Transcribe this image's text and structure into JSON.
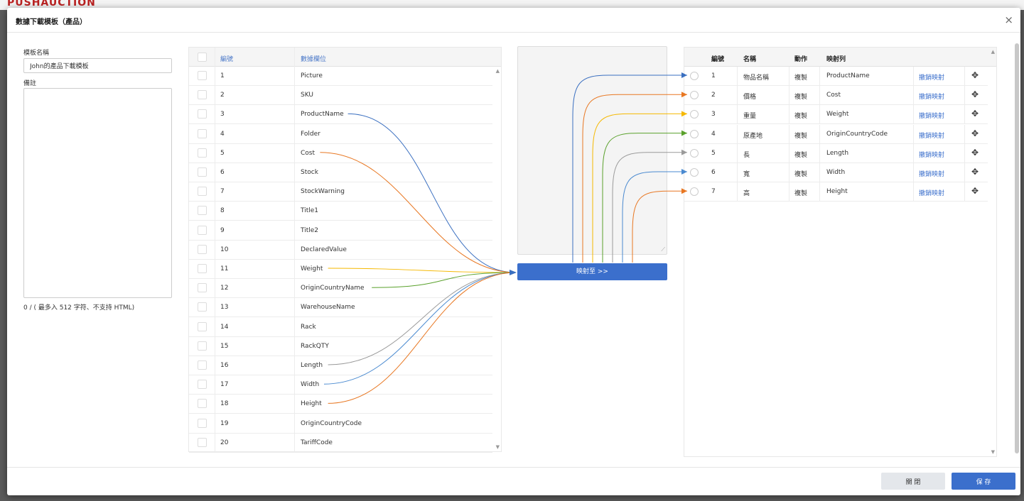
{
  "background": {
    "logo": "PUSHAUCTION"
  },
  "modal": {
    "title": "數據下載模板（產品）",
    "close_icon": "×"
  },
  "form": {
    "name_label": "模板名稱",
    "name_value": "John的產品下載模板",
    "note_label": "備註",
    "counter": "0 / ( 最多入 512 字符、不支持 HTML)"
  },
  "source": {
    "headers": {
      "number": "編號",
      "field": "數據欄位"
    },
    "rows": [
      {
        "n": "1",
        "field": "Picture"
      },
      {
        "n": "2",
        "field": "SKU"
      },
      {
        "n": "3",
        "field": "ProductName"
      },
      {
        "n": "4",
        "field": "Folder"
      },
      {
        "n": "5",
        "field": "Cost"
      },
      {
        "n": "6",
        "field": "Stock"
      },
      {
        "n": "7",
        "field": "StockWarning"
      },
      {
        "n": "8",
        "field": "Title1"
      },
      {
        "n": "9",
        "field": "Title2"
      },
      {
        "n": "10",
        "field": "DeclaredValue"
      },
      {
        "n": "11",
        "field": "Weight"
      },
      {
        "n": "12",
        "field": "OriginCountryName"
      },
      {
        "n": "13",
        "field": "WarehouseName"
      },
      {
        "n": "14",
        "field": "Rack"
      },
      {
        "n": "15",
        "field": "RackQTY"
      },
      {
        "n": "16",
        "field": "Length"
      },
      {
        "n": "17",
        "field": "Width"
      },
      {
        "n": "18",
        "field": "Height"
      },
      {
        "n": "19",
        "field": "OriginCountryCode"
      },
      {
        "n": "20",
        "field": "TariffCode"
      }
    ]
  },
  "map_button": "映射至 >>",
  "target": {
    "headers": {
      "number": "編號",
      "name": "名稱",
      "action": "動作",
      "column": "映射列"
    },
    "rows": [
      {
        "n": "1",
        "name": "物品名稱",
        "action": "複製",
        "column": "ProductName",
        "undo": "撤銷映射"
      },
      {
        "n": "2",
        "name": "價格",
        "action": "複製",
        "column": "Cost",
        "undo": "撤銷映射"
      },
      {
        "n": "3",
        "name": "重量",
        "action": "複製",
        "column": "Weight",
        "undo": "撤銷映射"
      },
      {
        "n": "4",
        "name": "原產地",
        "action": "複製",
        "column": "OriginCountryCode",
        "undo": "撤銷映射"
      },
      {
        "n": "5",
        "name": "長",
        "action": "複製",
        "column": "Length",
        "undo": "撤銷映射"
      },
      {
        "n": "6",
        "name": "寬",
        "action": "複製",
        "column": "Width",
        "undo": "撤銷映射"
      },
      {
        "n": "7",
        "name": "高",
        "action": "複製",
        "column": "Height",
        "undo": "撤銷映射"
      }
    ]
  },
  "mappings": [
    {
      "source": "ProductName",
      "target_row": "1",
      "color": "#3a6fc0"
    },
    {
      "source": "Cost",
      "target_row": "2",
      "color": "#e87722"
    },
    {
      "source": "Weight",
      "target_row": "3",
      "color": "#f5b800"
    },
    {
      "source": "OriginCountryName",
      "target_row": "4",
      "color": "#5aa12c"
    },
    {
      "source": "Length",
      "target_row": "5",
      "color": "#9a9a9a"
    },
    {
      "source": "Width",
      "target_row": "6",
      "color": "#4a8ad0"
    },
    {
      "source": "Height",
      "target_row": "7",
      "color": "#e87722"
    }
  ],
  "footer": {
    "close_label": "關 閉",
    "save_label": "保 存"
  }
}
